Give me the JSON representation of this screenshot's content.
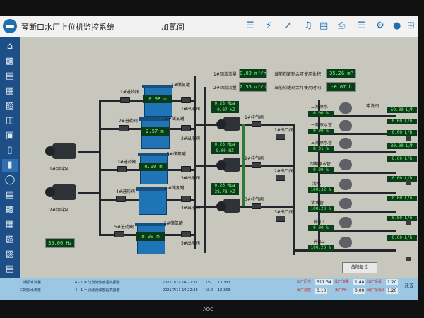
{
  "header": {
    "app_title": "琴断口水厂上位机监控系统",
    "page_title": "加氯间",
    "toolbar_icons": [
      "hierarchy-icon",
      "lightning-icon",
      "trend-icon",
      "bell-icon",
      "document-icon",
      "print-icon",
      "menu-icon",
      "gear-icon",
      "user-icon",
      "exit-icon"
    ]
  },
  "sidebar": {
    "icons": [
      "home-icon",
      "factory-icon",
      "building-icon",
      "grid-icon",
      "panel-icon",
      "equipment-icon",
      "screen-icon",
      "document-icon",
      "battery-icon",
      "bicycle-icon",
      "meter-icon",
      "chart-icon",
      "table-icon",
      "valve-icon",
      "storage-icon",
      "config-icon",
      "hand-icon"
    ]
  },
  "flow_meters": [
    {
      "label": "1#回流流量",
      "value": "0.00  m³/h"
    },
    {
      "label": "2#回流流量",
      "value": "2.55  m³/h"
    }
  ],
  "tank_usage": [
    {
      "label": "当前药罐剩余可使用体积",
      "value": "35.26  m³"
    },
    {
      "label": "当前药罐剩余可使用时间",
      "value": "-0.07  h"
    }
  ],
  "tanks": [
    {
      "label": "1#储氯罐",
      "level": "0.08  m"
    },
    {
      "label": "2#储氯罐",
      "level": "2.57  m"
    },
    {
      "label": "3#储氯罐",
      "level": "0.00  m"
    },
    {
      "label": "4#储氯罐",
      "level": ""
    },
    {
      "label": "5#储氯罐",
      "level": "0.00  m"
    }
  ],
  "inlet_valves": [
    "1#进药阀",
    "2#进药阀",
    "3#进药阀",
    "4#进药阀",
    "5#进药阀"
  ],
  "outlet_valves": [
    "1#出液阀",
    "2#出液阀",
    "3#出液阀",
    "4#出液阀",
    "5#出液阀"
  ],
  "unload_pumps": [
    "1#卸料泵",
    "2#卸料泵"
  ],
  "unload_freq": "35.00  Hz",
  "dosing_pumps": [
    {
      "pressure": "0.28  Mpa",
      "freq": "-0.07  HZ"
    },
    {
      "pressure": "0.28  Mpa",
      "freq": "0.00  HZ"
    },
    {
      "pressure": "0.26  Mpa",
      "freq": "38.78  HZ"
    }
  ],
  "exhaust_valves": [
    "1#排气阀",
    "2#排气阀",
    "3#排气阀"
  ],
  "pump_outlet_valves": [
    "1#出口阀",
    "2#出口阀",
    "3#出口阀"
  ],
  "dosing_points": [
    {
      "name": "二期原水",
      "flow": "0.00  %"
    },
    {
      "name": "一期原水管",
      "flow": "0.00  %"
    },
    {
      "name": "三期原水管",
      "flow": "8.31  %"
    },
    {
      "name": "四期原水管",
      "flow": "0.00  %"
    },
    {
      "name": "清水",
      "flow": "100.32 %"
    },
    {
      "name": "清水管",
      "flow": "100.20 %"
    },
    {
      "name": "补加1",
      "flow": "0.00  %"
    },
    {
      "name": "补加2",
      "flow": "100.20 %"
    }
  ],
  "dosing_point_extra": "冲洗阀",
  "right_readouts": [
    "59.00  L/h",
    "0.00  L/h",
    "0.00  L/h",
    "80.00  L/h",
    "0.00  L/h",
    "0.00  L/h",
    "0.00  L/h",
    "0.00  L/h",
    "0.00  L/h"
  ],
  "reset_label": "故障复位",
  "alarms": [
    {
      "source": "二期原水流量",
      "message": "4 - 1 = 沉淀池浊度超高报警",
      "time": "2021/7/15 14:22:37",
      "v1": "3.5",
      "v2": "10.363"
    },
    {
      "source": "三期原水流量",
      "message": "4 - 1 = 沉淀池浊度超高报警",
      "time": "2021/7/15 14:22:38",
      "v1": "10.0",
      "v2": "10.363"
    }
  ],
  "stats": [
    {
      "label": "出厂压力",
      "value": "311.34"
    },
    {
      "label": "出厂流量",
      "value": "1.48"
    },
    {
      "label": "出厂余氯",
      "value": "1.20"
    },
    {
      "label": "出厂浊度",
      "value": "0.10"
    },
    {
      "label": "出厂PH",
      "value": "0.00"
    },
    {
      "label": "出厂余氯2",
      "value": "1.20"
    }
  ],
  "stats_side": "武汉",
  "monitor_brand": "AOC"
}
